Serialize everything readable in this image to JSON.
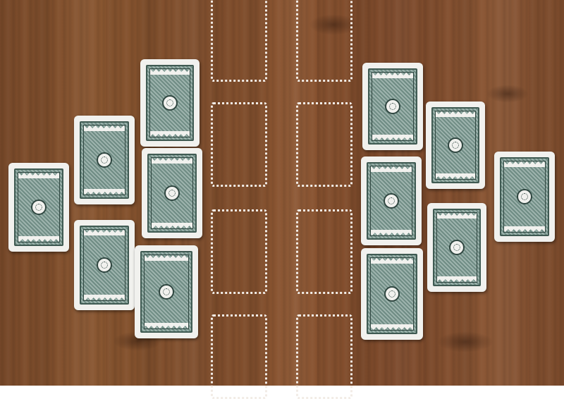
{
  "scene": {
    "surface": "wooden-table",
    "colors": {
      "wood": "#7e4d2d",
      "slot_outline": "#f2ece6",
      "card_face": "#f1f1ee",
      "card_pattern": "#6f8c84",
      "card_ink": "#2f4640"
    }
  },
  "slots": [
    {
      "id": "left-column-1"
    },
    {
      "id": "left-column-2"
    },
    {
      "id": "left-column-3"
    },
    {
      "id": "left-column-4"
    },
    {
      "id": "right-column-1"
    },
    {
      "id": "right-column-2"
    },
    {
      "id": "right-column-3"
    },
    {
      "id": "right-column-4"
    }
  ],
  "cards": {
    "left_group": [
      {
        "id": "card-left-1",
        "face": "down"
      },
      {
        "id": "card-left-2",
        "face": "down"
      },
      {
        "id": "card-left-3",
        "face": "down"
      },
      {
        "id": "card-left-4",
        "face": "down"
      },
      {
        "id": "card-left-5",
        "face": "down"
      },
      {
        "id": "card-left-6",
        "face": "down"
      }
    ],
    "right_group": [
      {
        "id": "card-right-1",
        "face": "down"
      },
      {
        "id": "card-right-2",
        "face": "down"
      },
      {
        "id": "card-right-3",
        "face": "down"
      },
      {
        "id": "card-right-4",
        "face": "down"
      },
      {
        "id": "card-right-5",
        "face": "down"
      },
      {
        "id": "card-right-6",
        "face": "down"
      }
    ]
  }
}
